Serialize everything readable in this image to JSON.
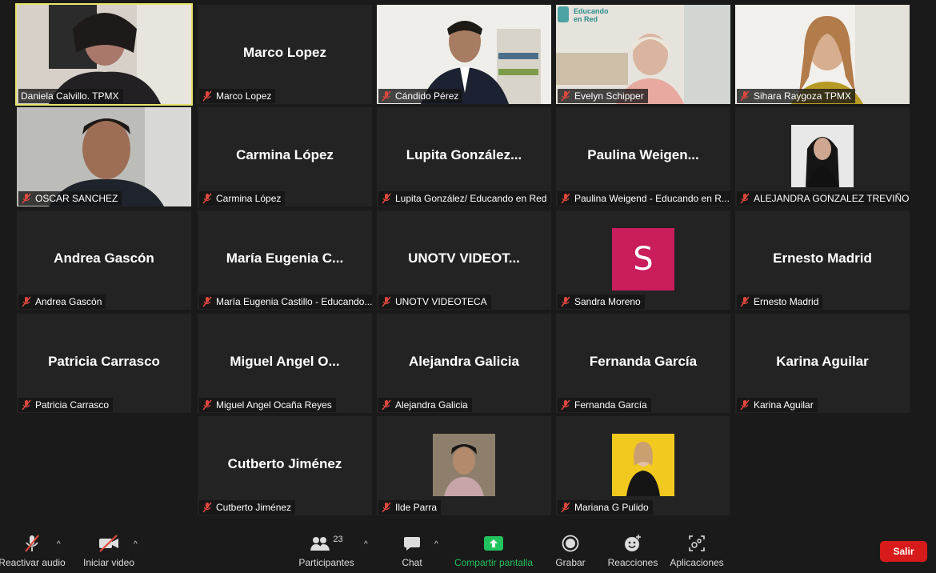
{
  "participants": [
    {
      "label": "Daniela Calvillo. TPMX",
      "display": "",
      "video": true
    },
    {
      "label": "Marco Lopez",
      "display": "Marco Lopez",
      "video": false
    },
    {
      "label": "Cándido Pérez",
      "display": "",
      "video": true
    },
    {
      "label": "Evelyn Schipper",
      "display": "",
      "video": true
    },
    {
      "label": "Sihara Raygoza TPMX",
      "display": "",
      "video": true
    },
    {
      "label": "OSCAR SANCHEZ",
      "display": "",
      "video": true
    },
    {
      "label": "Carmina López",
      "display": "Carmina López",
      "video": false
    },
    {
      "label": "Lupita González/ Educando en Red",
      "display": "Lupita  González...",
      "video": false
    },
    {
      "label": "Paulina Weigend - Educando en R...",
      "display": "Paulina  Weigen...",
      "video": false
    },
    {
      "label": "ALEJANDRA GONZALEZ TREVIÑO",
      "display": "",
      "video": false
    },
    {
      "label": "Andrea Gascón",
      "display": "Andrea Gascón",
      "video": false
    },
    {
      "label": "María Eugenia Castillo - Educando...",
      "display": "María  Eugenia  C...",
      "video": false
    },
    {
      "label": "UNOTV VIDEOTECA",
      "display": "UNOTV  VIDEOT...",
      "video": false
    },
    {
      "label": "Sandra Moreno",
      "display": "",
      "initial": "S",
      "video": false
    },
    {
      "label": "Ernesto Madrid",
      "display": "Ernesto Madrid",
      "video": false
    },
    {
      "label": "Patricia Carrasco",
      "display": "Patricia Carrasco",
      "video": false
    },
    {
      "label": "Miguel Angel Ocaña Reyes",
      "display": "Miguel  Angel  O...",
      "video": false
    },
    {
      "label": "Alejandra Galicia",
      "display": "Alejandra Galicia",
      "video": false
    },
    {
      "label": "Fernanda García",
      "display": "Fernanda García",
      "video": false
    },
    {
      "label": "Karina Aguilar",
      "display": "Karina Aguilar",
      "video": false
    },
    {
      "label": "Cutberto Jiménez",
      "display": "Cutberto Jiménez",
      "video": false
    },
    {
      "label": "Ilde Parra",
      "display": "",
      "video": false
    },
    {
      "label": "Mariana G Pulido",
      "display": "",
      "video": false
    }
  ],
  "background_logo": "Educando en Red",
  "toolbar": {
    "unmute": "Reactivar audio",
    "start_video": "Iniciar video",
    "participants": "Participantes",
    "participant_count": "23",
    "chat": "Chat",
    "share": "Compartir pantalla",
    "record": "Grabar",
    "reactions": "Reacciones",
    "apps": "Aplicaciones",
    "leave": "Salir"
  },
  "colors": {
    "active_speaker": "#e8e46a",
    "share": "#22c35e",
    "leave": "#d71b1b",
    "mute_icon": "#e0483e"
  }
}
